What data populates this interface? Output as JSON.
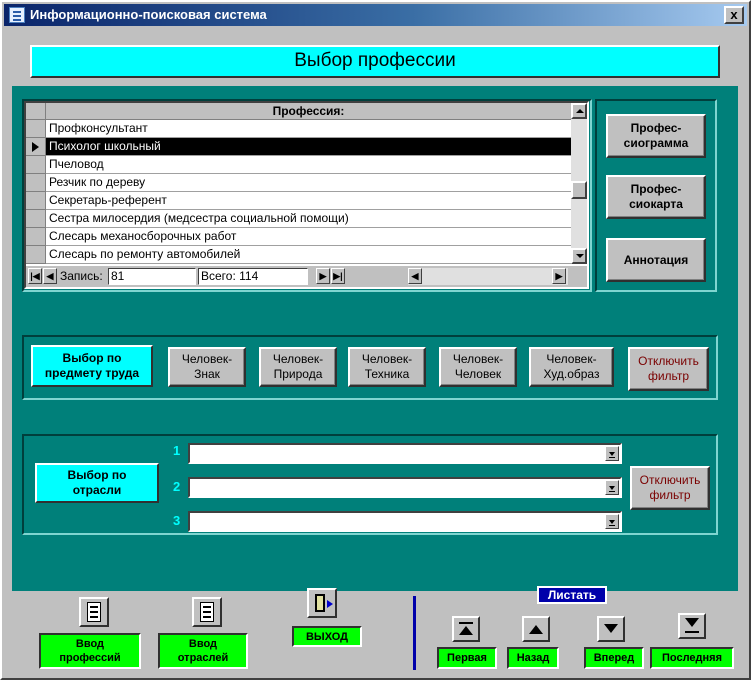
{
  "window": {
    "title": "Информационно-поисковая система",
    "close_label": "x"
  },
  "header": {
    "title": "Выбор  профессии"
  },
  "list": {
    "column_header": "Профессия:",
    "rows": [
      "Профконсультант",
      "Психолог школьный",
      "Пчеловод",
      "Резчик по дереву",
      "Секретарь-референт",
      "Сестра милосердия (медсестра социальной помощи)",
      "Слесарь механосборочных работ",
      "Слесарь по ремонту автомобилей"
    ],
    "selected_index": 1,
    "record_label": "Запись:",
    "record_value": "81",
    "total_label": "Всего: 114"
  },
  "side_buttons": {
    "professiogram": "Профес-\nсиограмма",
    "professiocard": "Профес-\nсиокарта",
    "annotation": "Аннотация"
  },
  "subject_filter": {
    "label": "Выбор по\nпредмету труда",
    "buttons": [
      "Человек-\nЗнак",
      "Человек-\nПрирода",
      "Человек-\nТехника",
      "Человек-\nЧеловек",
      "Человек-\nХуд.образ"
    ],
    "off": "Отключить\nфильтр"
  },
  "branch_filter": {
    "label": "Выбор по\nотрасли",
    "numbers": [
      "1",
      "2",
      "3"
    ],
    "combos": [
      "",
      "",
      ""
    ],
    "off": "Отключить\nфильтр"
  },
  "bottom": {
    "input_professions": "Ввод\nпрофессий",
    "input_branches": "Ввод\nотраслей",
    "exit": "ВЫХОД",
    "paging_title": "Листать",
    "first": "Первая",
    "back": "Назад",
    "forward": "Вперед",
    "last": "Последняя"
  },
  "colors": {
    "form_bg": "#00807a",
    "accent_cyan": "#00ffff",
    "accent_green": "#00ff00",
    "title_blue": "#0a246a"
  },
  "icons": [
    "app-icon",
    "close-icon",
    "record-selector-icon",
    "form-icon",
    "exit-door-icon",
    "first-record-icon",
    "previous-record-icon",
    "next-record-icon",
    "last-record-icon"
  ]
}
